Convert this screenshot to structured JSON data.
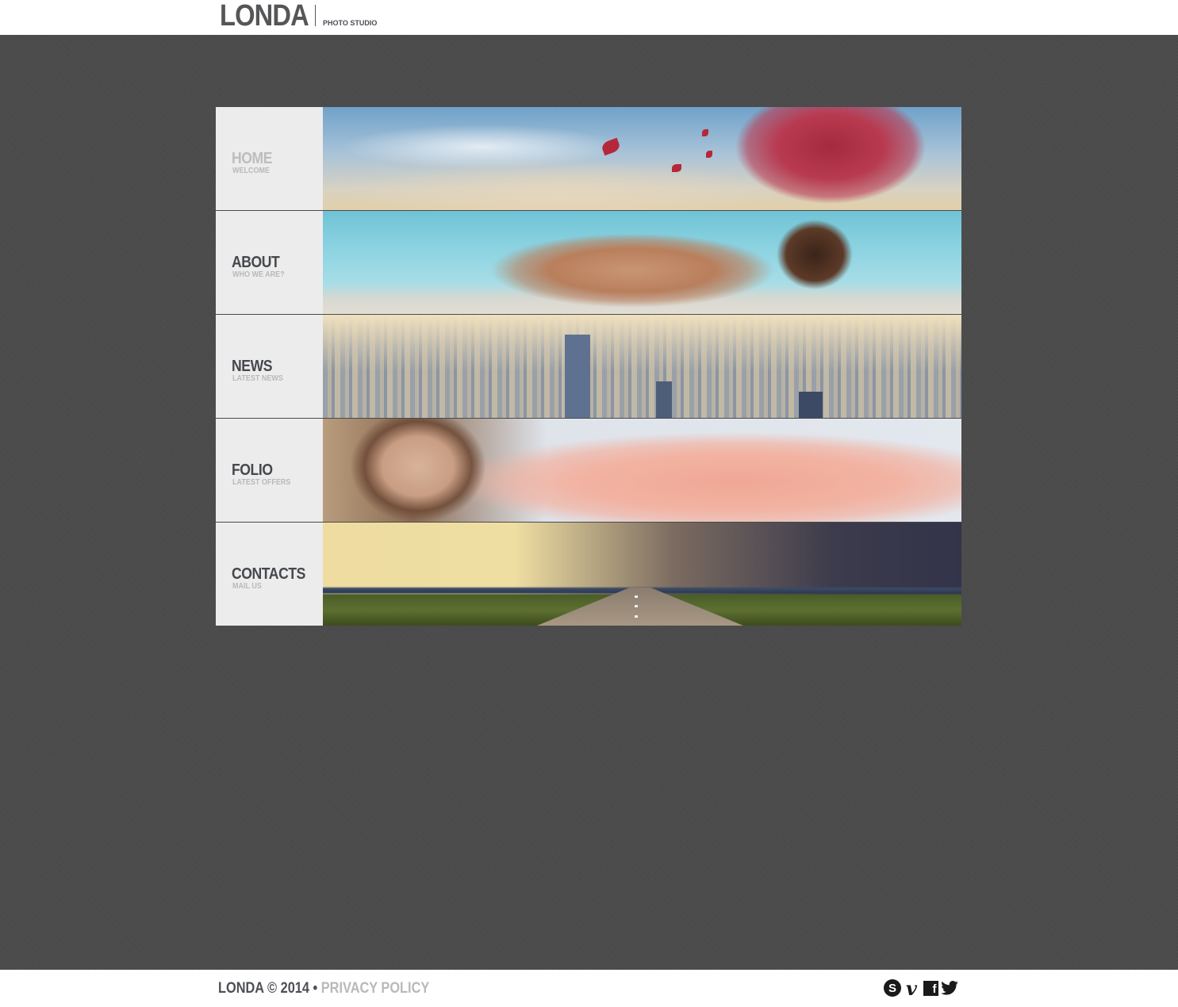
{
  "header": {
    "logo": "LONDA",
    "tagline": "PHOTO STUDIO"
  },
  "nav": {
    "items": [
      {
        "title": "HOME",
        "subtitle": "WELCOME",
        "active": true,
        "photo": "sky with heart-shaped red tree"
      },
      {
        "title": "ABOUT",
        "subtitle": "WHO WE ARE?",
        "active": false,
        "photo": "model lying by pool"
      },
      {
        "title": "NEWS",
        "subtitle": "LATEST NEWS",
        "active": false,
        "photo": "city skyline"
      },
      {
        "title": "FOLIO",
        "subtitle": "LATEST OFFERS",
        "active": false,
        "photo": "woman in pink dress"
      },
      {
        "title": "CONTACTS",
        "subtitle": "MAIL US",
        "active": false,
        "photo": "storm over road"
      }
    ]
  },
  "footer": {
    "brand": "LONDA",
    "copyright": "© 2014",
    "separator": "•",
    "privacy": "PRIVACY POLICY",
    "social": [
      {
        "name": "skype-icon",
        "glyph": "S"
      },
      {
        "name": "vimeo-icon",
        "glyph": "v"
      },
      {
        "name": "facebook-icon",
        "glyph": "f"
      },
      {
        "name": "twitter-icon",
        "glyph": "🐦"
      }
    ]
  },
  "colors": {
    "background": "#4b4b4b",
    "label_bg": "#ececec",
    "title": "#45484d",
    "subtitle": "#b9b9bb",
    "active_title": "#bdbdbf"
  }
}
